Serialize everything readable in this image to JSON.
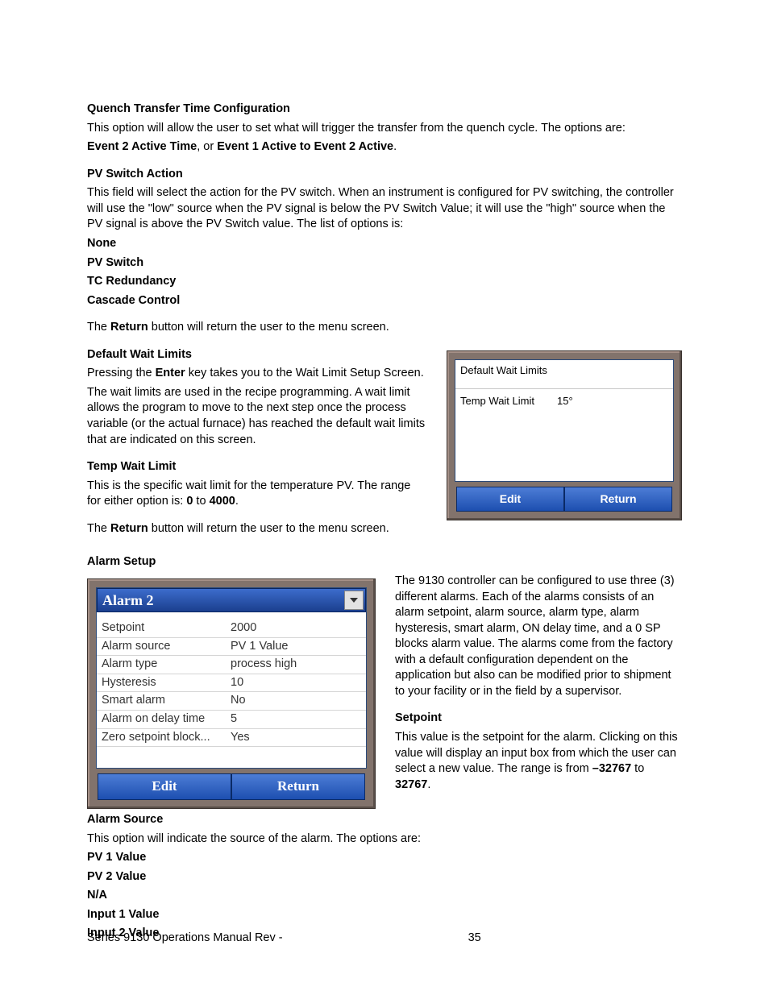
{
  "sections": {
    "quench": {
      "heading": "Quench Transfer Time Configuration",
      "body1a": "This option will allow the user to set what will trigger the transfer from the quench cycle.  The options are:",
      "opt1": "Event 2 Active Time",
      "optSep": ", or ",
      "opt2": "Event 1 Active to Event 2 Active",
      "period": "."
    },
    "pvswitch": {
      "heading": "PV Switch Action",
      "body": "This field will select the action for the PV switch.  When an instrument is configured for PV switching, the controller will use the \"low\" source when the PV signal is below the PV Switch Value; it will use the \"high\" source when the PV signal is above the PV Switch value.  The list of options is:",
      "opts": [
        "None",
        "PV Switch",
        "TC Redundancy",
        "Cascade Control"
      ]
    },
    "returnLine": {
      "pre": "The ",
      "bold": "Return",
      "post": " button will return the user to the menu screen."
    },
    "waitLimits": {
      "heading": "Default Wait Limits",
      "p1a": "Pressing the ",
      "p1b": "Enter",
      "p1c": " key takes you to the Wait Limit Setup Screen.",
      "p2": "The wait limits are used in the recipe programming. A wait limit allows the program to move to the next step once the process variable (or the actual furnace) has reached the default wait limits that are indicated on this screen."
    },
    "tempWait": {
      "heading": "Temp Wait Limit",
      "bodyA": "This is the specific wait limit for the temperature PV.  The range for either option is: ",
      "r0": "0",
      "mid": " to ",
      "r1": "4000",
      "period": "."
    },
    "alarmSetup": {
      "heading": "Alarm Setup",
      "right1": "The 9130 controller can be configured to use three (3) different alarms. Each of the alarms consists of an alarm setpoint, alarm source, alarm type, alarm hysteresis, smart alarm, ON delay time, and a 0 SP blocks alarm value. The alarms come from the factory with a default configuration dependent on the application but also can be modified prior to shipment to your facility or in the field by a supervisor.",
      "setpointHeading": "Setpoint",
      "setpointBodyA": "This value is the setpoint for the alarm.  Clicking on this value will display an input box from which the user can select a new value.  The range is from ",
      "spMin": "–32767",
      "spMid": " to ",
      "spMax": "32767",
      "spPeriod": "."
    },
    "alarmSource": {
      "heading": "Alarm Source",
      "body": "This option will indicate the source of the alarm.  The options are:",
      "opts": [
        "PV 1 Value",
        "PV 2 Value",
        "N/A",
        "Input 1 Value",
        "Input 2 Value"
      ]
    }
  },
  "figWait": {
    "title": "Default Wait Limits",
    "rowLabel": "Temp Wait Limit",
    "rowValue": "15°",
    "editBtn": "Edit",
    "returnBtn": "Return"
  },
  "figAlarm": {
    "ddLabel": "Alarm 2",
    "rows": [
      {
        "k": "Setpoint",
        "v": "2000"
      },
      {
        "k": "Alarm source",
        "v": "PV 1 Value"
      },
      {
        "k": "Alarm type",
        "v": "process high"
      },
      {
        "k": "Hysteresis",
        "v": "10"
      },
      {
        "k": "Smart alarm",
        "v": "No"
      },
      {
        "k": "Alarm on delay time",
        "v": "5"
      },
      {
        "k": "Zero setpoint block...",
        "v": "Yes"
      }
    ],
    "editBtn": "Edit",
    "returnBtn": "Return"
  },
  "footer": {
    "left": "Series 9130 Operations Manual Rev -",
    "page": "35"
  }
}
